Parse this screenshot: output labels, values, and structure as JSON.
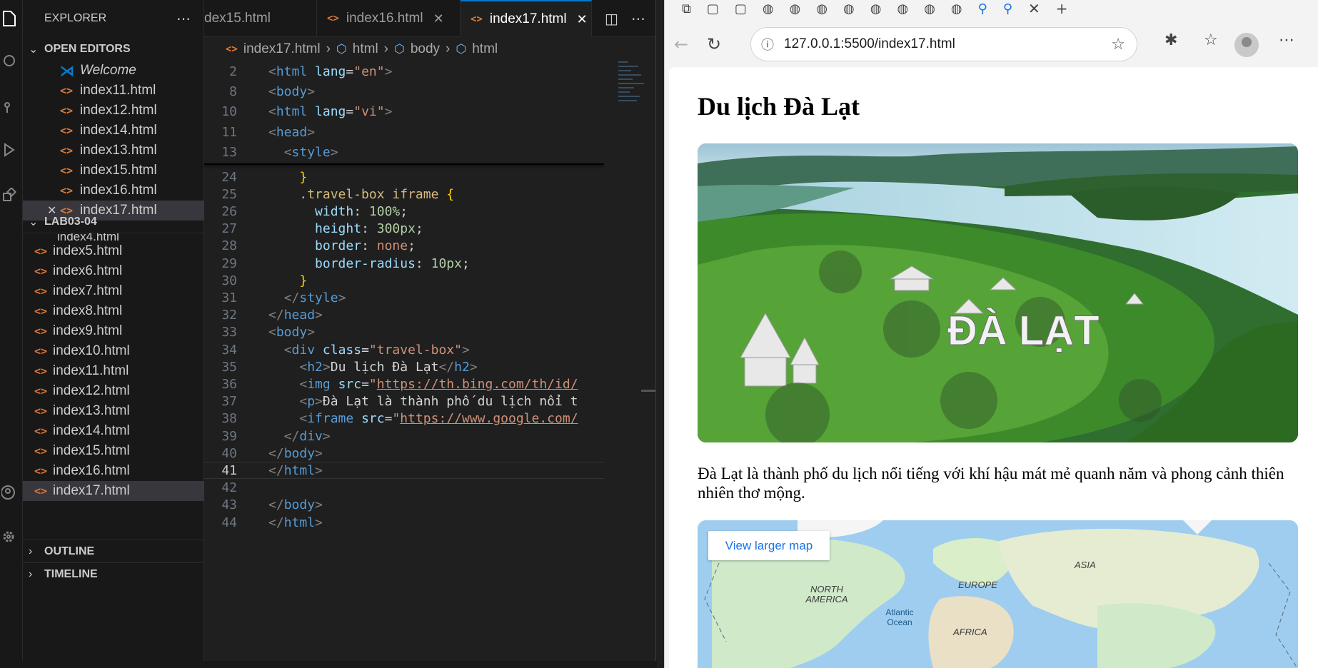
{
  "explorer": {
    "title": "EXPLORER",
    "open_editors_label": "OPEN EDITORS",
    "open_editors": [
      "Welcome",
      "index11.html",
      "index12.html",
      "index14.html",
      "index13.html",
      "index15.html",
      "index16.html",
      "index17.html"
    ],
    "folder_label": "LAB03-04",
    "folder_partial": "index4.html",
    "folder_files": [
      "index5.html",
      "index6.html",
      "index7.html",
      "index8.html",
      "index9.html",
      "index10.html",
      "index11.html",
      "index12.html",
      "index13.html",
      "index14.html",
      "index15.html",
      "index16.html",
      "index17.html"
    ],
    "outline_label": "OUTLINE",
    "timeline_label": "TIMELINE"
  },
  "tabs": [
    {
      "label": "dex15.html"
    },
    {
      "label": "index16.html"
    },
    {
      "label": "index17.html"
    }
  ],
  "breadcrumb": [
    "index17.html",
    "html",
    "body",
    "html"
  ],
  "code": {
    "sticky": [
      {
        "n": "2",
        "html": "<span class='t-br'>&lt;</span><span class='t-tag'>html</span> <span class='t-at'>lang</span><span class='t-pn'>=</span><span class='t-st'>\"en\"</span><span class='t-br'>&gt;</span>"
      },
      {
        "n": "8",
        "html": "<span class='t-br'>&lt;</span><span class='t-tag'>body</span><span class='t-br'>&gt;</span>"
      },
      {
        "n": "10",
        "html": "<span class='t-br'>&lt;</span><span class='t-tag'>html</span> <span class='t-at'>lang</span><span class='t-pn'>=</span><span class='t-st'>\"vi\"</span><span class='t-br'>&gt;</span>"
      },
      {
        "n": "11",
        "html": "<span class='t-br'>&lt;</span><span class='t-tag'>head</span><span class='t-br'>&gt;</span>"
      },
      {
        "n": "13",
        "html": "  <span class='t-br'>&lt;</span><span class='t-tag'>style</span><span class='t-br'>&gt;</span>"
      }
    ],
    "lines": [
      {
        "n": "24",
        "html": "    <span class='t-y'>}</span>"
      },
      {
        "n": "25",
        "html": "    <span class='t-sel'>.travel-box iframe</span> <span class='t-y'>{</span>"
      },
      {
        "n": "26",
        "html": "      <span class='t-p'>width</span><span class='t-pn'>: </span><span class='t-num'>100%</span><span class='t-pn'>;</span>"
      },
      {
        "n": "27",
        "html": "      <span class='t-p'>height</span><span class='t-pn'>: </span><span class='t-num'>300px</span><span class='t-pn'>;</span>"
      },
      {
        "n": "28",
        "html": "      <span class='t-p'>border</span><span class='t-pn'>: </span><span class='t-kw'>none</span><span class='t-pn'>;</span>"
      },
      {
        "n": "29",
        "html": "      <span class='t-p'>border-radius</span><span class='t-pn'>: </span><span class='t-num'>10px</span><span class='t-pn'>;</span>"
      },
      {
        "n": "30",
        "html": "    <span class='t-y'>}</span>"
      },
      {
        "n": "31",
        "html": "  <span class='t-br'>&lt;/</span><span class='t-tag'>style</span><span class='t-br'>&gt;</span>"
      },
      {
        "n": "32",
        "html": "<span class='t-br'>&lt;/</span><span class='t-tag'>head</span><span class='t-br'>&gt;</span>"
      },
      {
        "n": "33",
        "html": "<span class='t-br'>&lt;</span><span class='t-tag'>body</span><span class='t-br'>&gt;</span>"
      },
      {
        "n": "34",
        "html": "  <span class='t-br'>&lt;</span><span class='t-tag'>div</span> <span class='t-at'>class</span><span class='t-pn'>=</span><span class='t-st'>\"travel-box\"</span><span class='t-br'>&gt;</span>"
      },
      {
        "n": "35",
        "html": "    <span class='t-br'>&lt;</span><span class='t-tag'>h2</span><span class='t-br'>&gt;</span><span class='t-tx'>Du lịch Đà Lạt</span><span class='t-br'>&lt;/</span><span class='t-tag'>h2</span><span class='t-br'>&gt;</span>"
      },
      {
        "n": "36",
        "html": "    <span class='t-br'>&lt;</span><span class='t-tag'>img</span> <span class='t-at'>src</span><span class='t-pn'>=</span><span class='t-st'>\"<span class='u'>https://th.bing.com/th/id/</span></span>"
      },
      {
        "n": "37",
        "html": "    <span class='t-br'>&lt;</span><span class='t-tag'>p</span><span class='t-br'>&gt;</span><span class='t-tx'>Đà Lạt là thành phố du lịch nổi t</span>"
      },
      {
        "n": "38",
        "html": "    <span class='t-br'>&lt;</span><span class='t-tag'>iframe</span> <span class='t-at'>src</span><span class='t-pn'>=</span><span class='t-st'>\"<span class='u'>https://www.google.com/</span></span>"
      },
      {
        "n": "39",
        "html": "  <span class='t-br'>&lt;/</span><span class='t-tag'>div</span><span class='t-br'>&gt;</span>"
      },
      {
        "n": "40",
        "html": "<span class='t-br'>&lt;/</span><span class='t-tag'>body</span><span class='t-br'>&gt;</span>"
      },
      {
        "n": "41",
        "html": "<span class='t-br'>&lt;/</span><span class='t-tag'>html</span><span class='t-br'>&gt;</span>"
      },
      {
        "n": "42",
        "html": ""
      },
      {
        "n": "43",
        "html": "<span class='t-br'>&lt;/</span><span class='t-tag'>body</span><span class='t-br'>&gt;</span>"
      },
      {
        "n": "44",
        "html": "<span class='t-br'>&lt;/</span><span class='t-tag'>html</span><span class='t-br'>&gt;</span>"
      }
    ],
    "current_line": "41"
  },
  "browser": {
    "url": "127.0.0.1:5500/index17.html",
    "page": {
      "heading": "Du lịch Đà Lạt",
      "image_caption": "ĐÀ LẠT",
      "paragraph": "Đà Lạt là thành phố du lịch nổi tiếng với khí hậu mát mẻ quanh năm và phong cảnh thiên nhiên thơ mộng.",
      "map_button": "View larger map",
      "map_labels": {
        "asia": "ASIA",
        "europe": "EUROPE",
        "north_america": "NORTH AMERICA",
        "atlantic": "Atlantic Ocean",
        "africa": "AFRICA"
      }
    }
  },
  "colors": {
    "accent": "#0078d4",
    "html_icon": "#e37933",
    "link": "#1a73e8"
  }
}
